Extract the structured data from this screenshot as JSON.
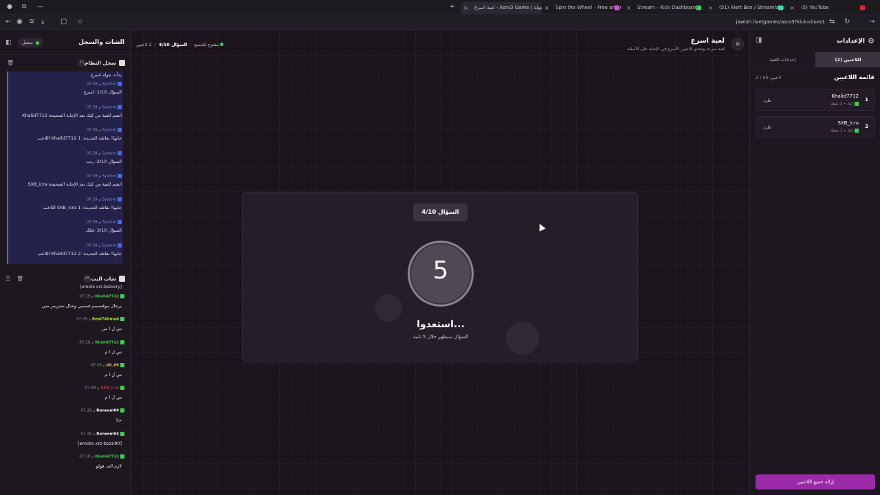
{
  "browser": {
    "tabs": [
      {
        "label": "لعبة اسرع - Asra3 Game | جولة"
      },
      {
        "label": "Spin the Wheel – Free and eas..."
      },
      {
        "label": "Stream – Kick Dashboard"
      },
      {
        "label": "(51) Alert Box / Streamlabs"
      },
      {
        "label": "(5) YouTube"
      }
    ],
    "url": "jawlah.live/games/asra3?kick=bozx1"
  },
  "left": {
    "title": "الشات والسجل",
    "status": "متصل",
    "system_log": {
      "title": "سجل النظام",
      "count": "11",
      "first_msg": "بدأت جولة اسرع",
      "entries": [
        {
          "time": "07:38 م",
          "user": "System",
          "msg": "السؤال 1/10: اسرع"
        },
        {
          "time": "07:39 م",
          "user": "System",
          "msg": "Khalid7712 انضم للعبة من كيك بعد الإجابة الصحيحة"
        },
        {
          "time": "07:39 م",
          "user": "System",
          "msg": "اللاعب Khalid7712 جابها! نقاطه الجديدة: 1"
        },
        {
          "time": "07:39 م",
          "user": "System",
          "msg": "السؤال 2/10: رتب"
        },
        {
          "time": "07:39 م",
          "user": "System",
          "msg": "SXB_icra انضم للعبة من كيك بعد الإجابة الصحيحة"
        },
        {
          "time": "07:39 م",
          "user": "System",
          "msg": "اللاعب SXB_icra جابها! نقاطه الجديدة: 1"
        },
        {
          "time": "07:39 م",
          "user": "System",
          "msg": "السؤال 3/10: فكك"
        },
        {
          "time": "07:39 م",
          "user": "System",
          "msg": "اللاعب Khalid7712 جابها! نقاطه الجديدة: 2"
        }
      ]
    },
    "live_chat": {
      "title": "شات البث",
      "count": "26",
      "top_emote": "[emote xrz-bozxcry]",
      "messages": [
        {
          "time": "07:39 م",
          "user": "Khalid7712",
          "color": "#3bd14f",
          "msg": "يرجال موقمممم قممني وشال ستريمر مني"
        },
        {
          "time": "07:39 م",
          "user": "Real7Ahmad",
          "color": "#b6f03c",
          "msg": "س ل ا من"
        },
        {
          "time": "07:39 م",
          "user": "Khalid7712",
          "color": "#3bd14f",
          "msg": "س ل ا م"
        },
        {
          "time": "07:39 م",
          "user": "A0_08",
          "color": "#f0c23c",
          "msg": "س ل ا م"
        },
        {
          "time": "07:39 م",
          "user": "SXB_icra",
          "color": "#d2304a",
          "msg": "س ل ا م"
        },
        {
          "time": "07:39 م",
          "user": "Raneem04",
          "color": "#ffffff",
          "msg": "حنا"
        },
        {
          "time": "07:39 م",
          "user": "Raneem04",
          "color": "#ffffff",
          "msg": "[emote xrz-bozx90]"
        },
        {
          "time": "07:39 م",
          "user": "Khalid7712",
          "color": "#3bd14f",
          "msg": "لازم الف فولو"
        }
      ]
    }
  },
  "main": {
    "game_title": "لعبة اسرع",
    "game_subtitle": "لعبة سرعة وتحدي للاعبين الأسرع في الإجابة على الأسئلة",
    "players_info": "2 لاعبين",
    "question_info": "السؤال 4/10",
    "mode_info": "مفتوح للجميع",
    "question_pill": "السؤال 4/10",
    "countdown": "5",
    "ready_title": "استعدوا...",
    "ready_sub": "السؤال سيظهر خلال 5 ثانية"
  },
  "right": {
    "title": "الإعدادات",
    "tab_players": "اللاعبين (2)",
    "tab_settings": "إعدادات اللعبة",
    "list_title": "قائمة اللاعبين",
    "list_count": "2 / 50 لاعبين",
    "players": [
      {
        "rank": "1",
        "name": "Khalid7712",
        "detail": "كيك • 2 نقطة",
        "kick": "طرد"
      },
      {
        "rank": "2",
        "name": "SXB_icra",
        "detail": "كيك • 1 نقطة",
        "kick": "طرد"
      }
    ],
    "clear_button": "إزالة جميع اللاعبين"
  }
}
